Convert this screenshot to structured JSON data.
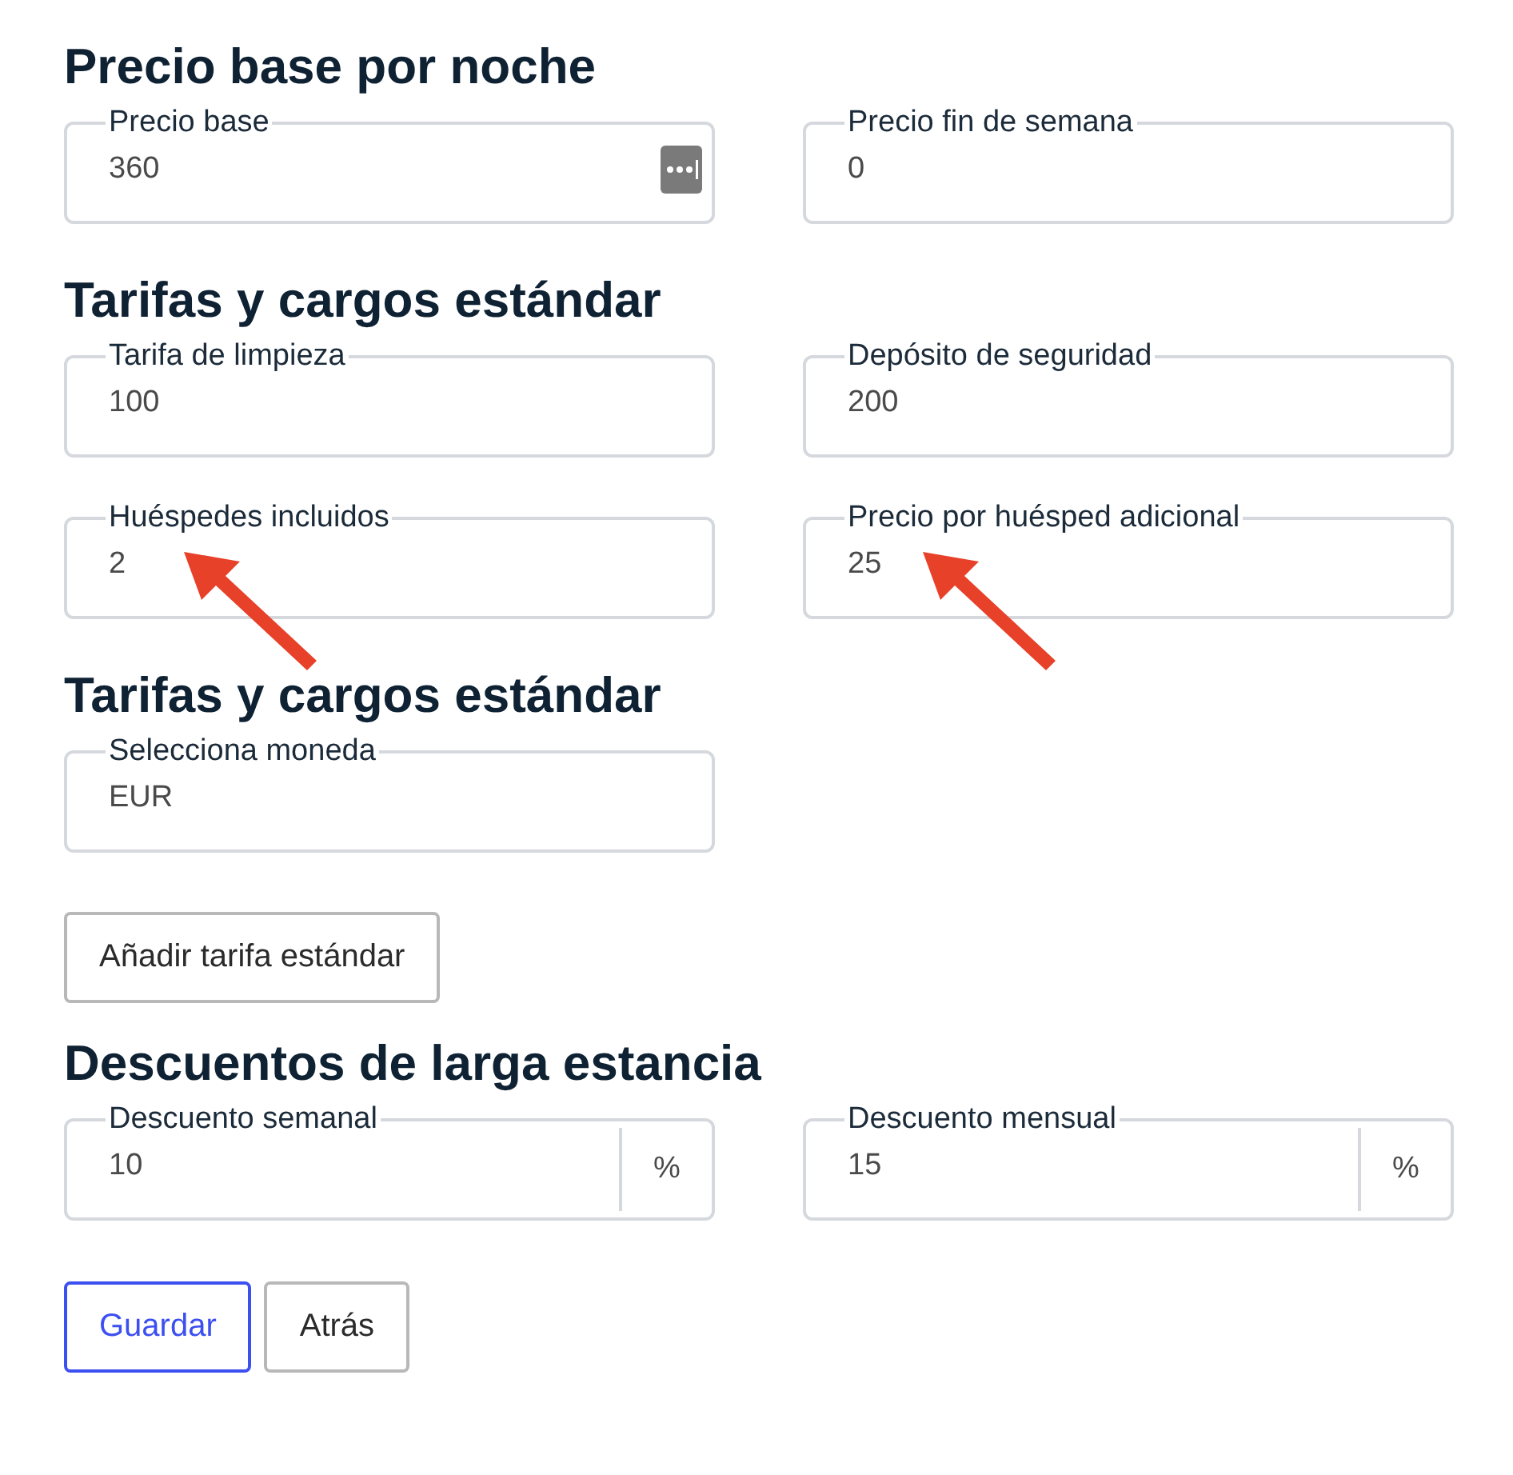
{
  "sections": [
    {
      "heading": "Precio base por noche",
      "fields": [
        {
          "label": "Precio base",
          "value": "360",
          "kind": "menu",
          "annotated": false
        },
        {
          "label": "Precio fin de semana",
          "value": "0",
          "kind": "text",
          "annotated": false
        }
      ]
    },
    {
      "heading": "Tarifas y cargos estándar",
      "fields": [
        {
          "label": "Tarifa de limpieza",
          "value": "100",
          "kind": "text",
          "annotated": false
        },
        {
          "label": "Depósito de seguridad",
          "value": "200",
          "kind": "text",
          "annotated": false
        },
        {
          "label": "Huéspedes incluidos",
          "value": "2",
          "kind": "text",
          "annotated": true
        },
        {
          "label": "Precio por huésped adicional",
          "value": "25",
          "kind": "text",
          "annotated": true
        }
      ]
    },
    {
      "heading": "Tarifas y cargos estándar",
      "fields": [
        {
          "label": "Selecciona moneda",
          "value": "EUR",
          "kind": "text",
          "annotated": false
        }
      ],
      "button": "Añadir tarifa estándar"
    },
    {
      "heading": "Descuentos de larga estancia",
      "fields": [
        {
          "label": "Descuento semanal",
          "value": "10",
          "kind": "percent",
          "suffix": "%",
          "annotated": false
        },
        {
          "label": "Descuento mensual",
          "value": "15",
          "kind": "percent",
          "suffix": "%",
          "annotated": false
        }
      ]
    }
  ],
  "buttons": [
    {
      "label": "Guardar",
      "kind": "primary"
    },
    {
      "label": "Atrás",
      "kind": "secondary"
    }
  ]
}
